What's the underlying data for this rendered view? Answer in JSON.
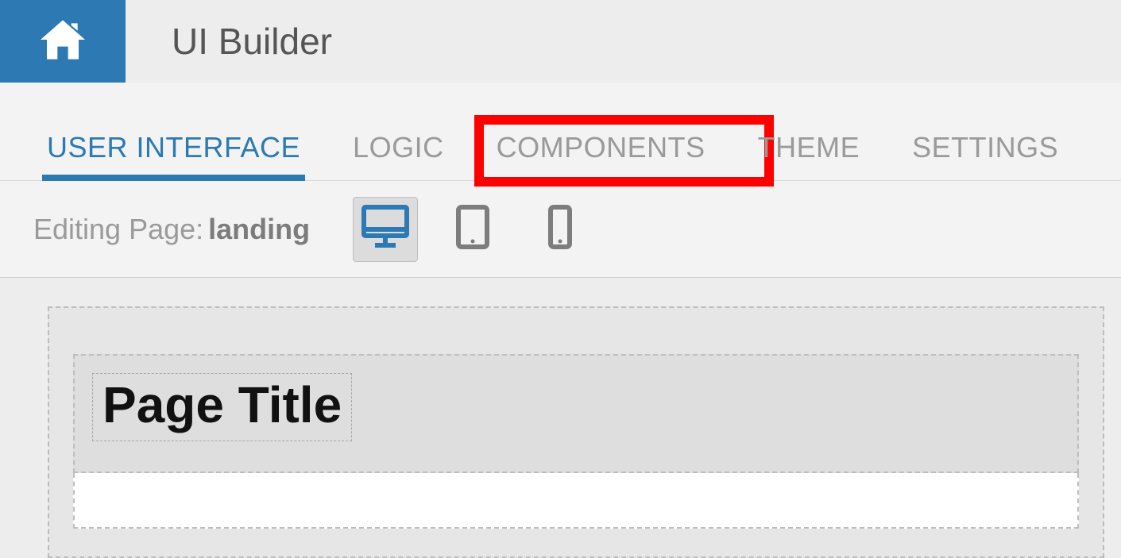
{
  "header": {
    "app_title": "UI Builder"
  },
  "tabs": {
    "items": [
      {
        "label": "USER INTERFACE",
        "active": true
      },
      {
        "label": "LOGIC",
        "active": false
      },
      {
        "label": "COMPONENTS",
        "active": false,
        "highlighted": true
      },
      {
        "label": "THEME",
        "active": false
      },
      {
        "label": "SETTINGS",
        "active": false
      }
    ]
  },
  "toolbar": {
    "editing_prefix": "Editing Page: ",
    "editing_page": "landing",
    "devices": [
      {
        "name": "desktop",
        "active": true
      },
      {
        "name": "tablet",
        "active": false
      },
      {
        "name": "phone",
        "active": false
      }
    ]
  },
  "canvas": {
    "page_title": "Page Title"
  }
}
